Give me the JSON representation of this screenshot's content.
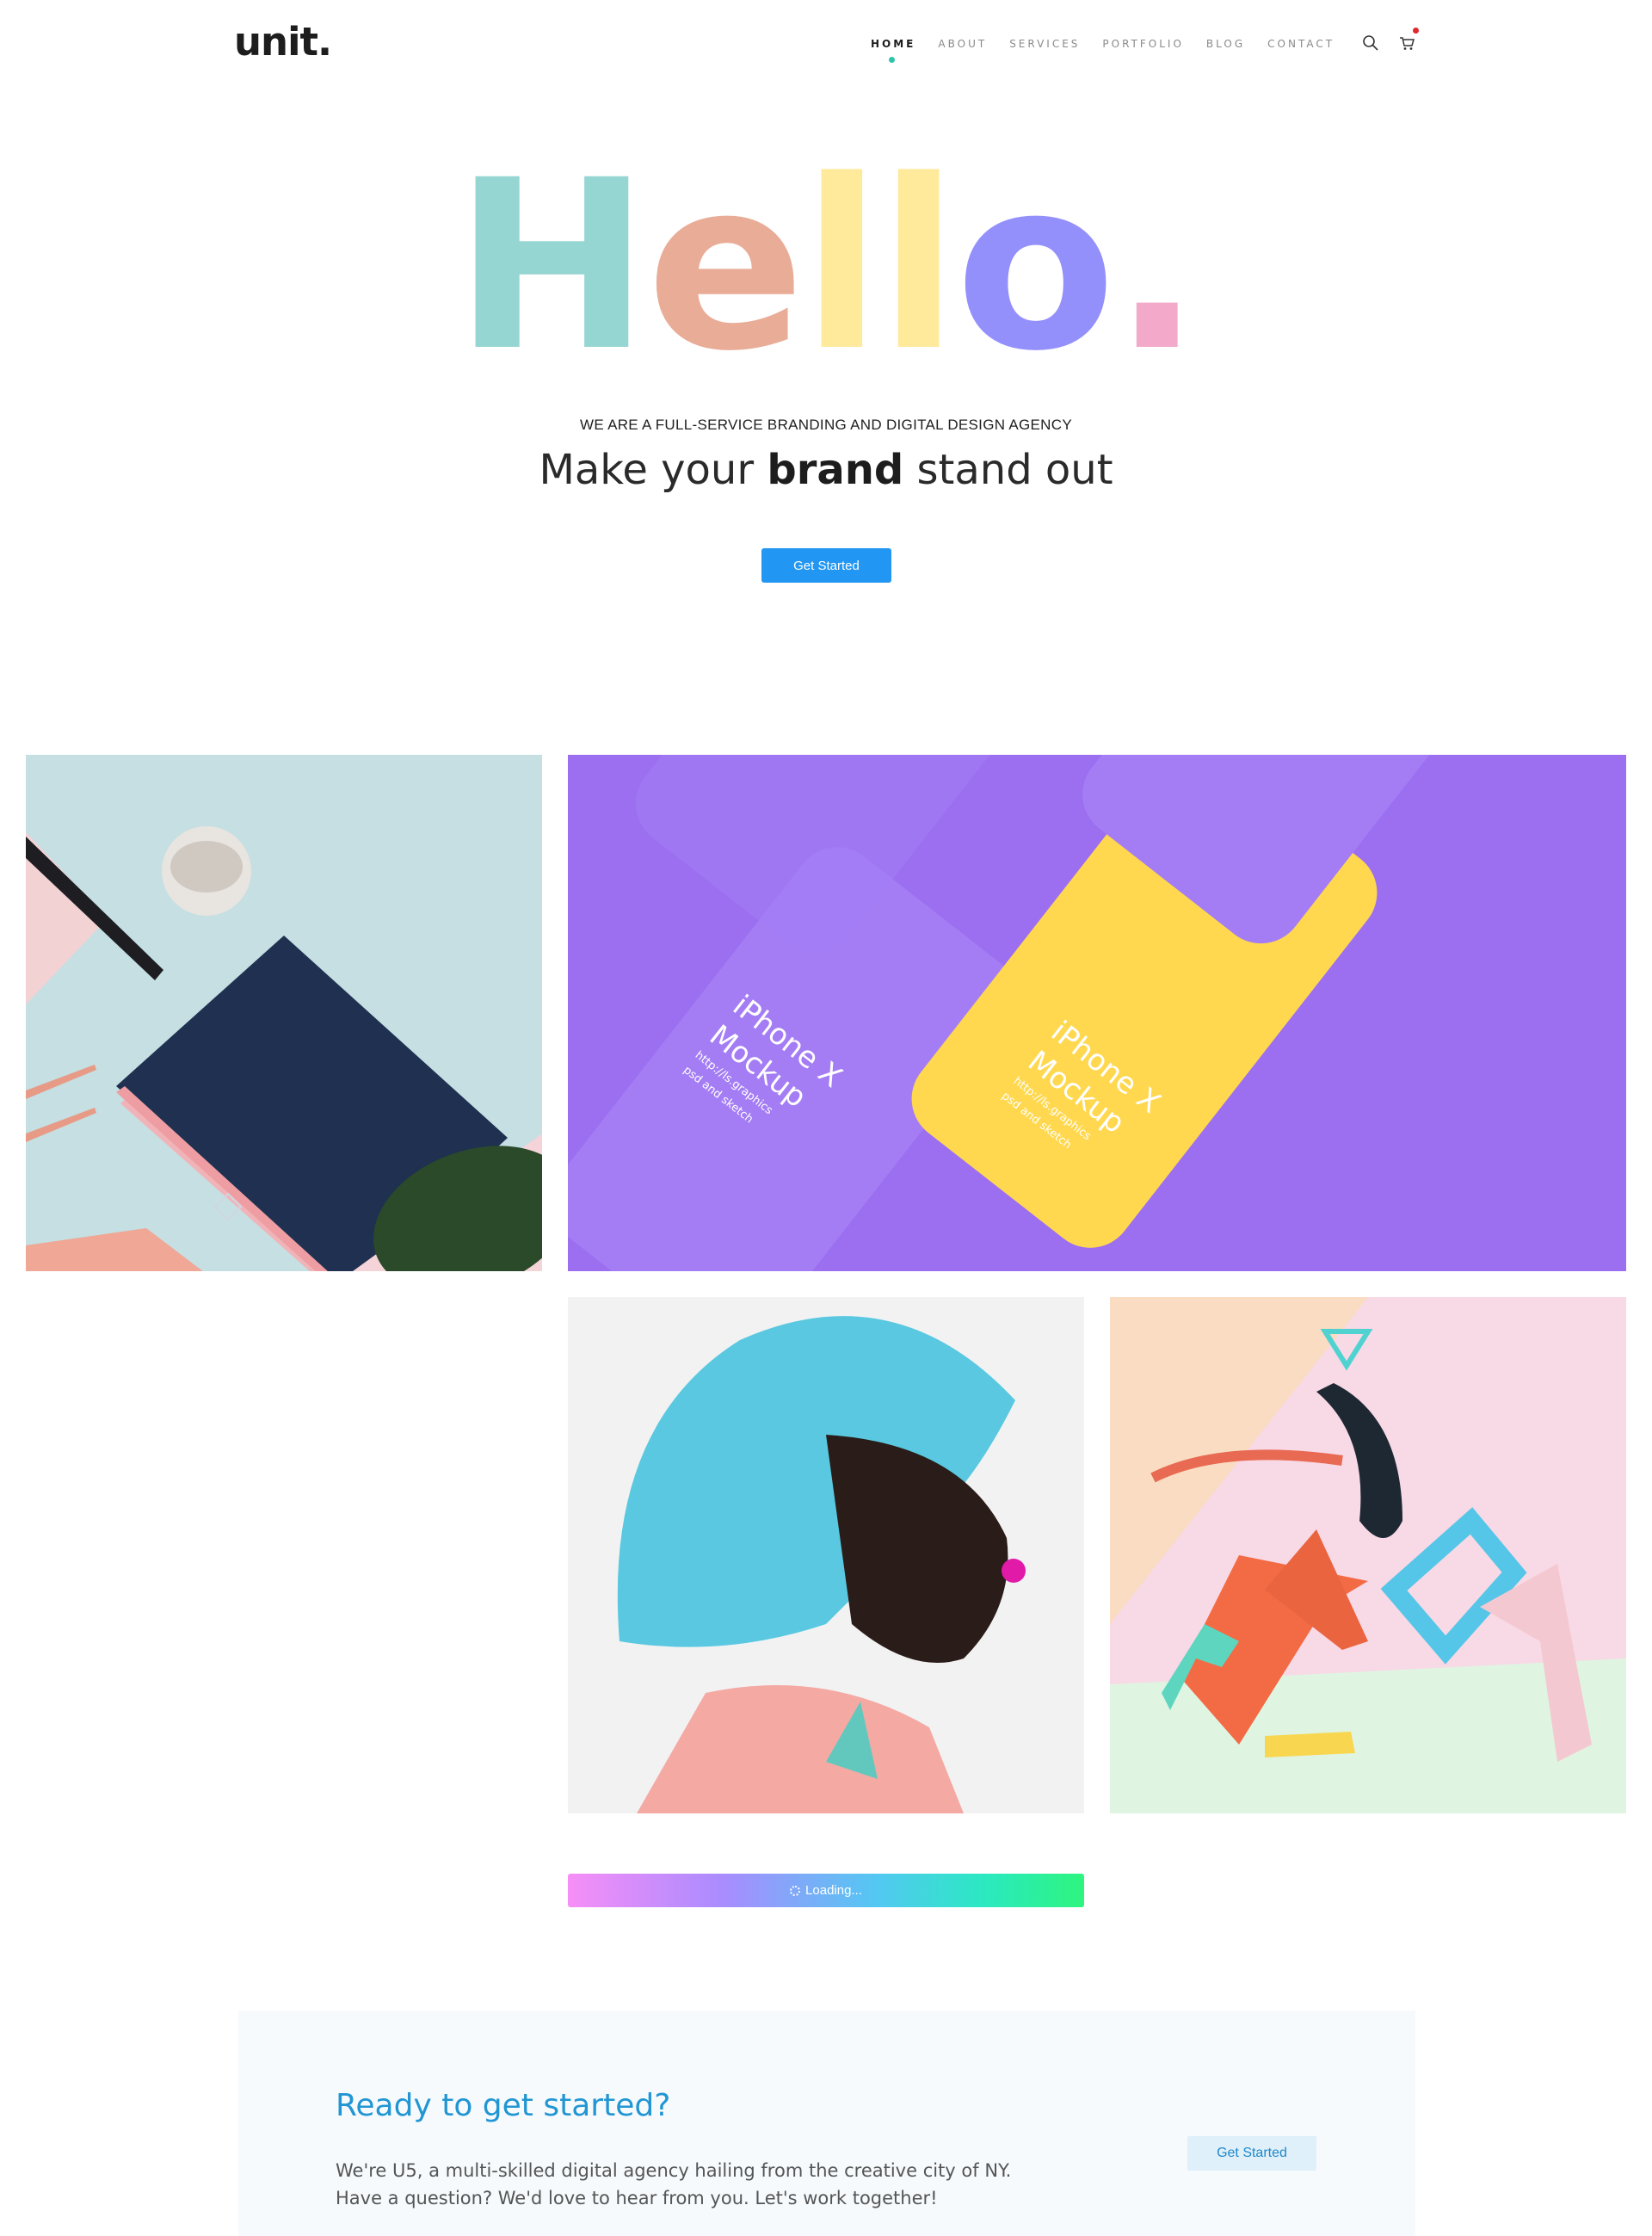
{
  "header": {
    "logo": "unit.",
    "nav": [
      {
        "label": "HOME",
        "active": true
      },
      {
        "label": "ABOUT"
      },
      {
        "label": "SERVICES"
      },
      {
        "label": "PORTFOLIO"
      },
      {
        "label": "BLOG"
      },
      {
        "label": "CONTACT"
      }
    ],
    "icons": [
      "search-icon",
      "cart-icon"
    ]
  },
  "hero": {
    "letters": [
      {
        "char": "H",
        "color": "#96d6d2"
      },
      {
        "char": "e",
        "color": "#e9ac97"
      },
      {
        "char": "l",
        "color": "#ffe99a"
      },
      {
        "char": "l",
        "color": "#ffe99a"
      },
      {
        "char": "o",
        "color": "#9390fb"
      },
      {
        "char": ".",
        "color": "#f3a9c9"
      }
    ],
    "tagline": "WE ARE A FULL-SERVICE BRANDING AND DIGITAL DESIGN AGENCY",
    "headline_pre": "Make your ",
    "headline_bold": "brand",
    "headline_post": " stand out",
    "button": "Get Started"
  },
  "portfolio": {
    "tiles": [
      {
        "name": "stationery-mockup"
      },
      {
        "name": "iphone-x-mockup",
        "phone_title_1": "iPhone X",
        "phone_title_2": "Mockup",
        "phone_url": "http://ls.graphics",
        "phone_note": "psd and sketch"
      },
      {
        "name": "blue-hair-portrait"
      },
      {
        "name": "abstract-3d-shapes"
      }
    ],
    "loading": "Loading..."
  },
  "cta": {
    "title": "Ready to get started?",
    "line1": "We're U5, a multi-skilled digital agency hailing from the creative city of NY.",
    "line2": "Have a question? We'd love to hear from you. Let's work together!",
    "button": "Get Started"
  },
  "colors": {
    "accent": "#2196f3",
    "cta_title": "#2196d3"
  }
}
